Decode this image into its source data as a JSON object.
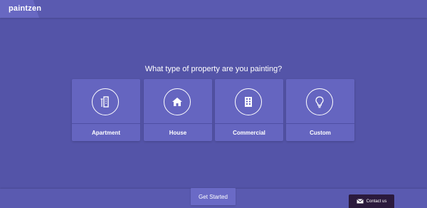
{
  "header": {
    "brand": "paintzen"
  },
  "main": {
    "question": "What type of property are you painting?",
    "options": [
      {
        "label": "Apartment",
        "icon": "apartment-icon"
      },
      {
        "label": "House",
        "icon": "house-icon"
      },
      {
        "label": "Commercial",
        "icon": "building-icon"
      },
      {
        "label": "Custom",
        "icon": "lightbulb-icon"
      }
    ]
  },
  "footer": {
    "get_started": "Get Started",
    "contact": "Contact us"
  },
  "colors": {
    "background": "#5454a8",
    "card": "#6565c0",
    "contact_bg": "#2b1a3d"
  }
}
